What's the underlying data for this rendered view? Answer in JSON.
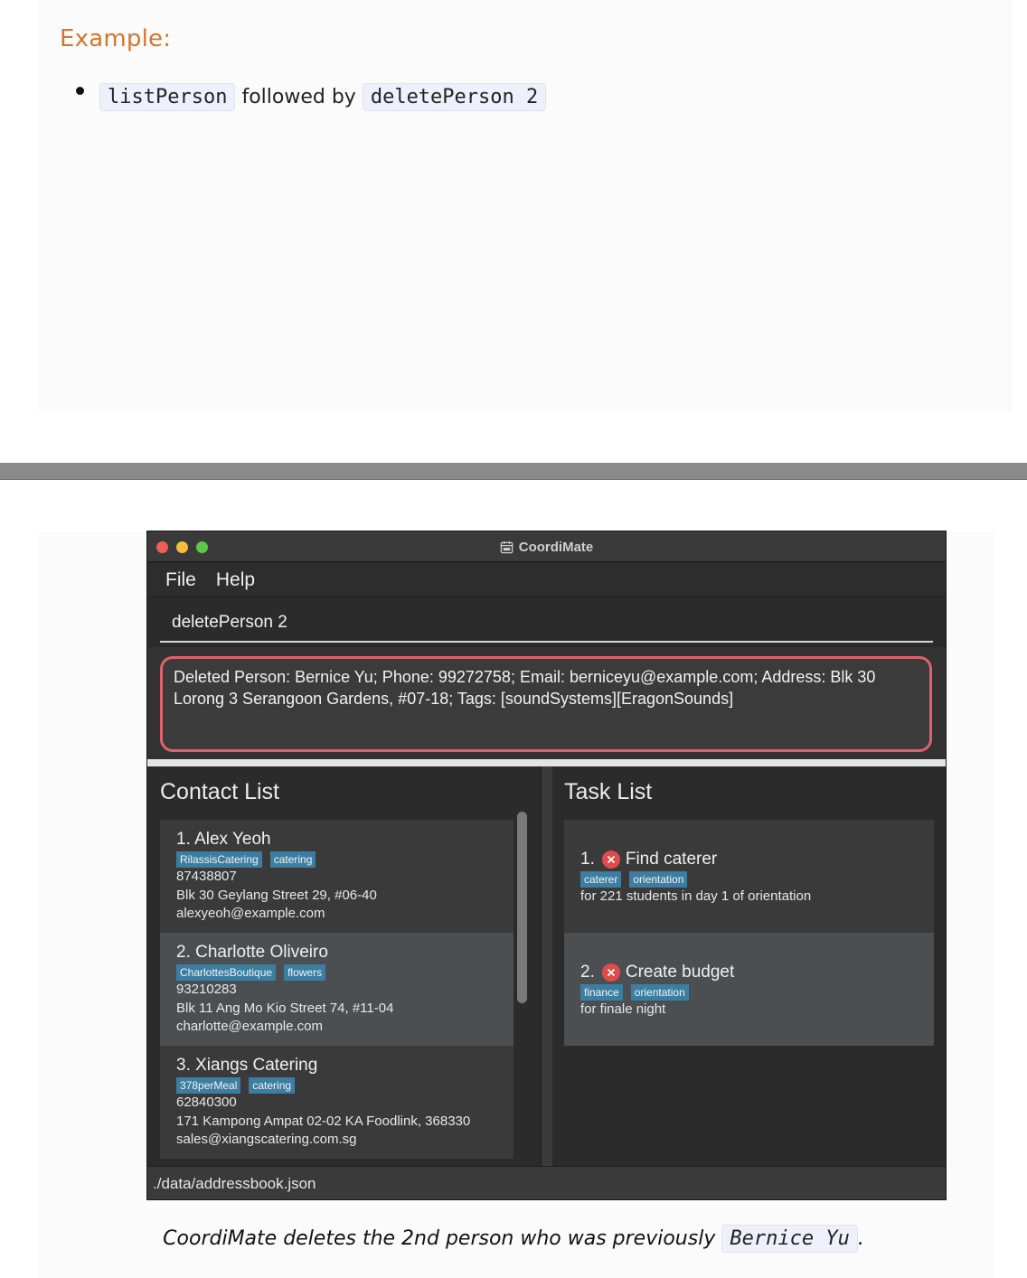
{
  "doc": {
    "heading": "Example:",
    "example": {
      "cmd1": "listPerson",
      "between": "followed by",
      "cmd2": "deletePerson 2"
    },
    "caption": {
      "text": "CoordiMate deletes the 2nd person who was previously",
      "code": "Bernice Yu",
      "tail": "."
    }
  },
  "app": {
    "title": "CoordiMate",
    "menu": [
      "File",
      "Help"
    ],
    "command": "deletePerson 2",
    "result": "Deleted Person: Bernice Yu; Phone: 99272758; Email: berniceyu@example.com; Address: Blk 30 Lorong 3 Serangoon Gardens, #07-18; Tags: [soundSystems][EragonSounds]",
    "contact_list": {
      "title": "Contact List",
      "items": [
        {
          "name": "1.  Alex Yeoh",
          "tags": [
            "RilassisCatering",
            "catering"
          ],
          "phone": "87438807",
          "address": "Blk 30 Geylang Street 29, #06-40",
          "email": "alexyeoh@example.com"
        },
        {
          "name": "2.  Charlotte Oliveiro",
          "tags": [
            "CharlottesBoutique",
            "flowers"
          ],
          "phone": "93210283",
          "address": "Blk 11 Ang Mo Kio Street 74, #11-04",
          "email": "charlotte@example.com"
        },
        {
          "name": "3.  Xiangs Catering",
          "tags": [
            "378perMeal",
            "catering"
          ],
          "phone": "62840300",
          "address": "171 Kampong Ampat 02-02 KA Foodlink, 368330",
          "email": "sales@xiangscatering.com.sg"
        }
      ]
    },
    "task_list": {
      "title": "Task List",
      "items": [
        {
          "index": "1.",
          "title": "Find caterer",
          "tags": [
            "caterer",
            "orientation"
          ],
          "note": "for 221 students in day 1 of orientation",
          "status_icon": "x-icon"
        },
        {
          "index": "2.",
          "title": "Create budget",
          "tags": [
            "finance",
            "orientation"
          ],
          "note": "for finale night",
          "status_icon": "x-icon"
        }
      ]
    },
    "status_bar": "./data/addressbook.json"
  }
}
